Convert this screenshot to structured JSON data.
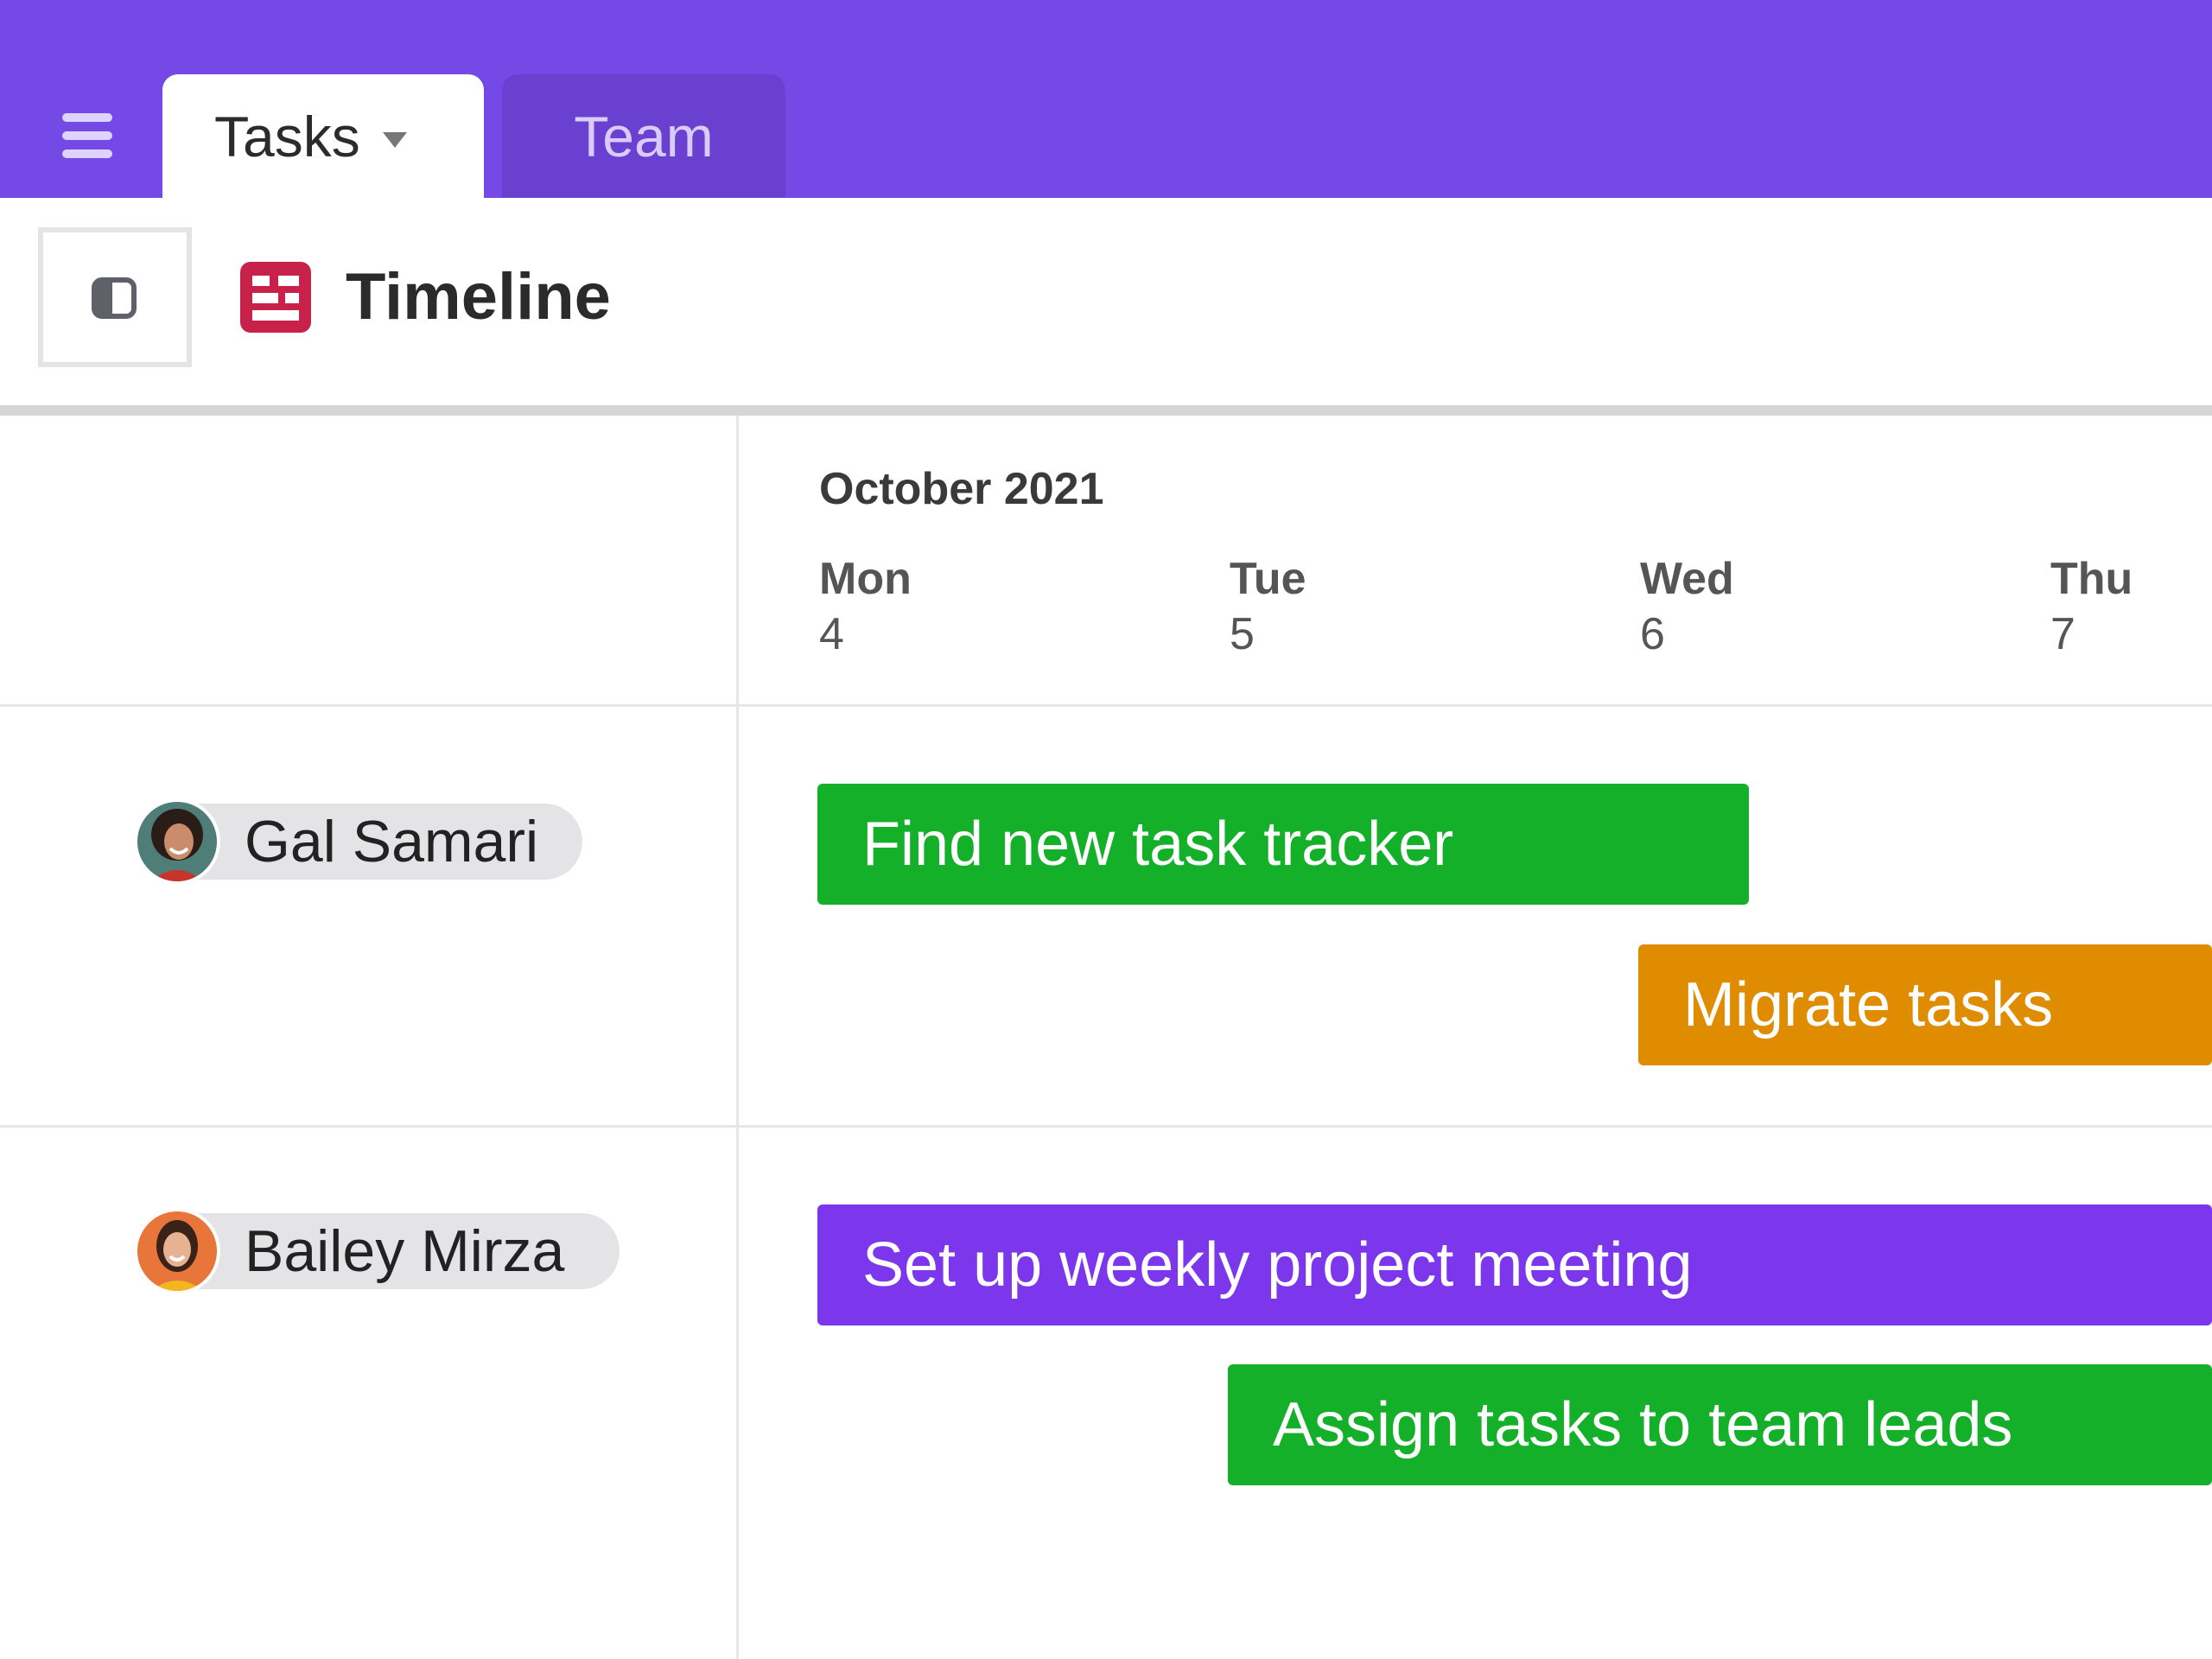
{
  "tabs": [
    {
      "label": "Tasks",
      "active": true
    },
    {
      "label": "Team",
      "active": false
    }
  ],
  "header": {
    "title": "Timeline",
    "toggle_icon": "sidebar-toggle-icon",
    "title_icon": "timeline-icon"
  },
  "timeline": {
    "month": "October 2021",
    "days": [
      {
        "name": "Mon",
        "num": "4"
      },
      {
        "name": "Tue",
        "num": "5"
      },
      {
        "name": "Wed",
        "num": "6"
      },
      {
        "name": "Thu",
        "num": "7"
      }
    ]
  },
  "people": [
    {
      "name": "Gal Samari",
      "tasks": [
        {
          "label": "Find new task tracker",
          "color": "#14b029"
        },
        {
          "label": "Migrate tasks",
          "color": "#e08c00"
        }
      ]
    },
    {
      "name": "Bailey Mirza",
      "tasks": [
        {
          "label": "Set up weekly project meeting",
          "color": "#7c36eb"
        },
        {
          "label": "Assign tasks to team leads",
          "color": "#14b029"
        }
      ]
    }
  ],
  "colors": {
    "topbar": "#7549e5",
    "team_tab": "#6a40d0",
    "timeline_icon": "#c8224a"
  }
}
